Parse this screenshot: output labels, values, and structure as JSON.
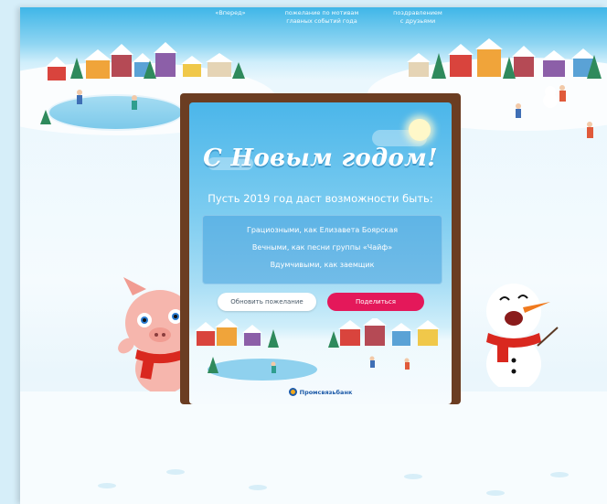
{
  "topnav": {
    "items": [
      "«Вперед»",
      "пожелание по мотивам\nглавных событий года",
      "поздравлением\nс друзьями"
    ]
  },
  "card": {
    "title": "С Новым годом!",
    "subtitle": "Пусть 2019 год даст возможности быть:",
    "wishes": [
      "Грациозными, как Елизавета Боярская",
      "Вечными, как песни группы «Чайф»",
      "Вдумчивыми, как заемщик"
    ],
    "refresh_button": "Обновить пожелание",
    "share_button": "Поделиться",
    "logo_text": "Промсвязьбанк"
  },
  "colors": {
    "share_button": "#e4185a",
    "frame": "#6b3d22",
    "sky": "#4bb6ea",
    "logo": "#1c5aa8"
  }
}
